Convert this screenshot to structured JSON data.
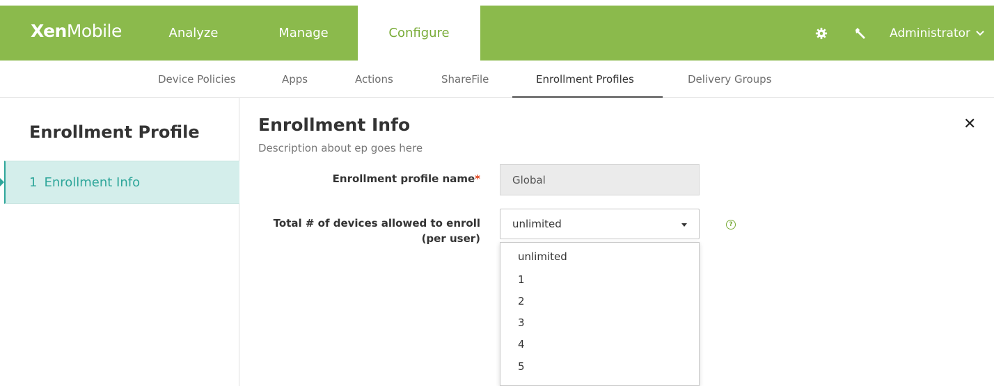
{
  "app": {
    "logo_bold": "Xen",
    "logo_light": "Mobile"
  },
  "topnav": {
    "tabs": [
      {
        "label": "Analyze"
      },
      {
        "label": "Manage"
      },
      {
        "label": "Configure",
        "active": true
      }
    ],
    "settings_icon": "gear-icon",
    "tools_icon": "wrench-icon",
    "user": "Administrator",
    "user_icon": "chevron-down-icon"
  },
  "subnav": {
    "items": [
      {
        "label": "Device Policies"
      },
      {
        "label": "Apps"
      },
      {
        "label": "Actions"
      },
      {
        "label": "ShareFile"
      },
      {
        "label": "Enrollment Profiles",
        "active": true
      },
      {
        "label": "Delivery Groups"
      }
    ]
  },
  "sidebar": {
    "title": "Enrollment Profile",
    "steps": [
      {
        "number": "1",
        "label": "Enrollment Info",
        "active": true
      }
    ]
  },
  "main": {
    "title": "Enrollment Info",
    "description": "Description about ep goes here",
    "close_icon": "close-icon",
    "fields": {
      "profile_name": {
        "label": "Enrollment profile name",
        "required_mark": "*",
        "value": "Global"
      },
      "devices_allowed": {
        "label_line1": "Total # of devices allowed to enroll",
        "label_line2": "(per user)",
        "value": "unlimited",
        "help_icon": "help-icon",
        "options": [
          "unlimited",
          "1",
          "2",
          "3",
          "4",
          "5"
        ]
      }
    }
  },
  "colors": {
    "brand_green": "#8bba4c",
    "active_text_green": "#7aac39",
    "teal_accent": "#2ea69a",
    "step_bg": "#d4eeeb"
  }
}
